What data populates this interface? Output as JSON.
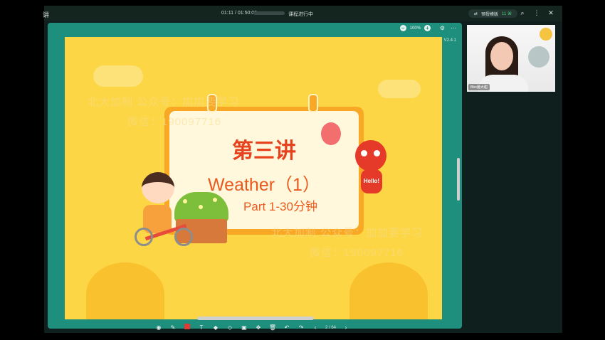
{
  "titlebar": {
    "app_title": "讲",
    "time": "01:11 / 01:50:00",
    "status": "课程进行中",
    "pill_label": "预授模版",
    "pill_value": "11 ⌘",
    "search_icon": "search-icon",
    "more_icon": "more-icon",
    "close_icon": "close-icon"
  },
  "board": {
    "zoom_level": "100%",
    "version": "V2.4.1"
  },
  "slide": {
    "title": "第三讲",
    "subtitle": "Weather（1）",
    "part": "Part 1-30分钟",
    "robot_text": "Hello!",
    "watermark_line1": "北大加制 公众号：加加要学习",
    "watermark_line2": "微信：190097716"
  },
  "toolbar": {
    "page": "2 / 64"
  },
  "video": {
    "name": "Bbo蕾大甜"
  },
  "colors": {
    "teal": "#1f8f7d",
    "slide_bg": "#fcd645",
    "title_red": "#e6421e"
  }
}
